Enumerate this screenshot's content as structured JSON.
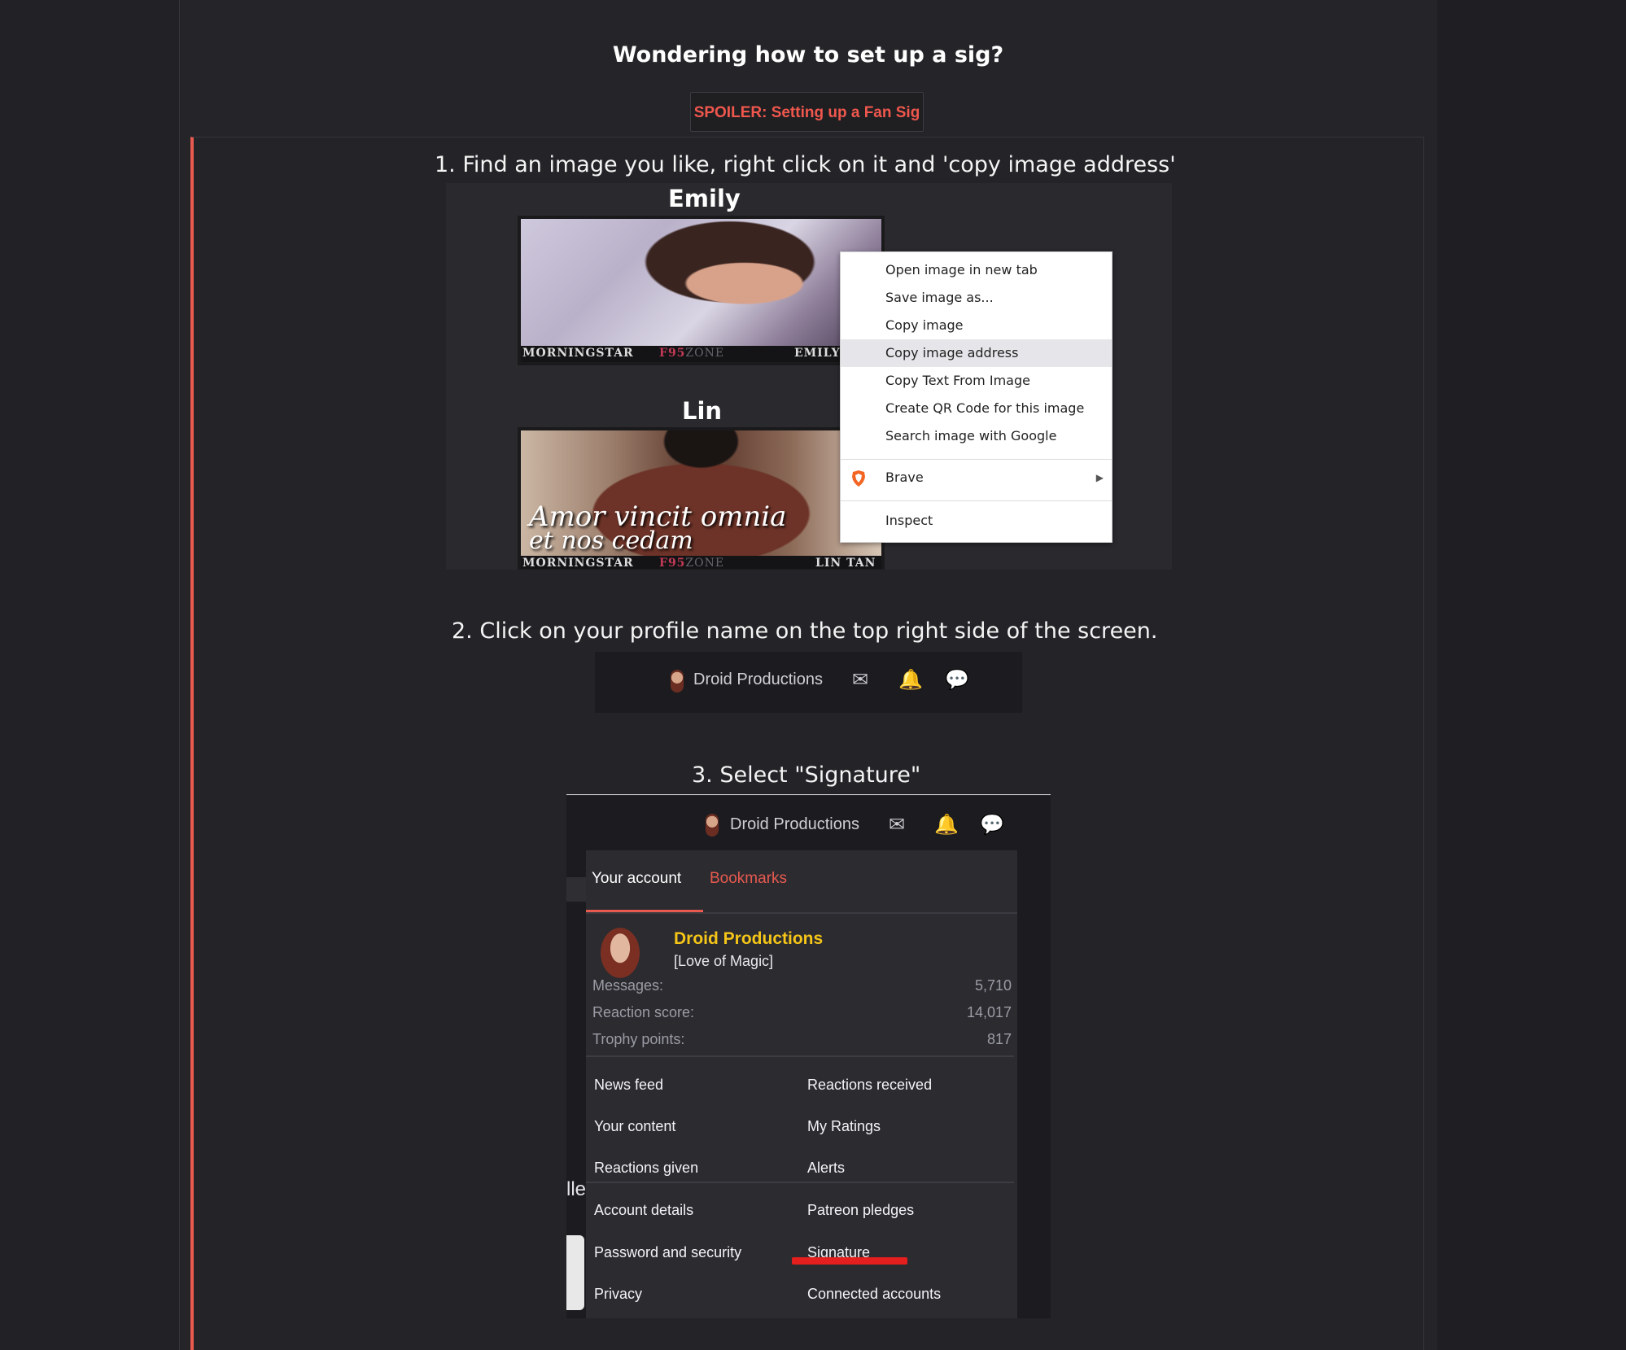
{
  "post": {
    "heading": "Wondering how to set up a sig?",
    "spoiler_label": "SPOILER: Setting up a Fan Sig"
  },
  "steps": [
    "1. Find an image you like, right click on it and 'copy image address'",
    "2. Click on your profile name on the top right side of the screen.",
    "3. Select \"Signature\""
  ],
  "step1_image": {
    "cards": [
      {
        "name": "Emily",
        "footer_left": "MORNINGSTAR",
        "footer_brand_a": "F95",
        "footer_brand_b": "ZONE",
        "footer_right": "EMILY"
      },
      {
        "name": "Lin",
        "footer_left": "MORNINGSTAR",
        "footer_brand_a": "F95",
        "footer_brand_b": "ZONE",
        "footer_right": "LIN TAN",
        "script_line1": "Amor vincit omnia",
        "script_line2": "et nos cedam"
      }
    ],
    "context_menu": {
      "items": [
        "Open image in new tab",
        "Save image as...",
        "Copy image",
        "Copy image address",
        "Copy Text From Image",
        "Create QR Code for this image",
        "Search image with Google"
      ],
      "highlighted": "Copy image address",
      "brave": "Brave",
      "inspect": "Inspect"
    }
  },
  "profile_bar": {
    "name": "Droid Productions",
    "icons": [
      "envelope-icon",
      "bell-icon",
      "alert-bubble-icon"
    ]
  },
  "account_menu": {
    "tabs": [
      "Your account",
      "Bookmarks"
    ],
    "user": {
      "name": "Droid Productions",
      "subtitle": "[Love of Magic]"
    },
    "stats": [
      {
        "label": "Messages:",
        "value": "5,710"
      },
      {
        "label": "Reaction score:",
        "value": "14,017"
      },
      {
        "label": "Trophy points:",
        "value": "817"
      }
    ],
    "links_left": [
      "News feed",
      "Your content",
      "Reactions given",
      "Account details",
      "Password and security",
      "Privacy"
    ],
    "links_right": [
      "Reactions received",
      "My Ratings",
      "Alerts",
      "Patreon pledges",
      "Signature",
      "Connected accounts"
    ],
    "background_fragment": "lle"
  },
  "colors": {
    "accent": "#e85a4f",
    "username": "#f5c518",
    "highlight_underline": "#e51e1e"
  }
}
